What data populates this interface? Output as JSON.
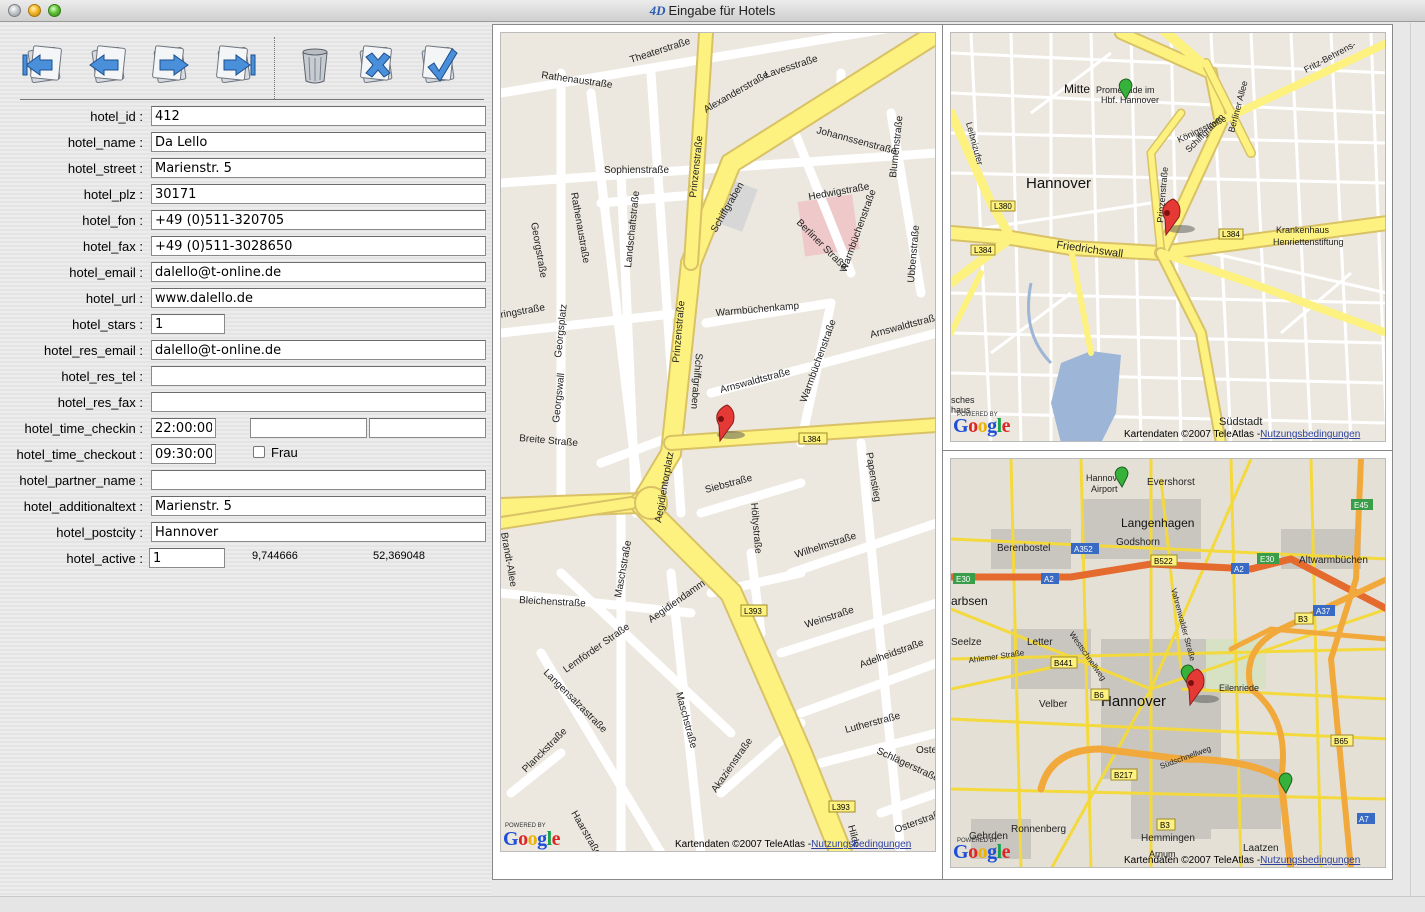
{
  "window": {
    "logo": "4D",
    "title": "Eingabe für Hotels"
  },
  "toolbar": {
    "buttons": [
      {
        "name": "first-record",
        "icon": "first-record-icon"
      },
      {
        "name": "previous-record",
        "icon": "previous-record-icon"
      },
      {
        "name": "next-record",
        "icon": "next-record-icon"
      },
      {
        "name": "last-record",
        "icon": "last-record-icon"
      },
      {
        "name": "delete-record",
        "icon": "trash-icon"
      },
      {
        "name": "cancel",
        "icon": "cancel-icon"
      },
      {
        "name": "accept",
        "icon": "accept-icon"
      }
    ]
  },
  "form": {
    "hotel_id": {
      "label": "hotel_id :",
      "value": "412"
    },
    "hotel_name": {
      "label": "hotel_name :",
      "value": "Da Lello"
    },
    "hotel_street": {
      "label": "hotel_street :",
      "value": "Marienstr. 5"
    },
    "hotel_plz": {
      "label": "hotel_plz :",
      "value": "30171"
    },
    "hotel_fon": {
      "label": "hotel_fon :",
      "value": "+49 (0)511-320705"
    },
    "hotel_fax": {
      "label": "hotel_fax :",
      "value": "+49 (0)511-3028650"
    },
    "hotel_email": {
      "label": "hotel_email :",
      "value": "dalello@t-online.de"
    },
    "hotel_url": {
      "label": "hotel_url :",
      "value": "www.dalello.de"
    },
    "hotel_stars": {
      "label": "hotel_stars :",
      "value": "1"
    },
    "hotel_res_email": {
      "label": "hotel_res_email :",
      "value": "dalello@t-online.de"
    },
    "hotel_res_tel": {
      "label": "hotel_res_tel :",
      "value": ""
    },
    "hotel_res_fax": {
      "label": "hotel_res_fax :",
      "value": ""
    },
    "hotel_time_checkin": {
      "label": "hotel_time_checkin :",
      "value": "22:00:00",
      "extra1": "",
      "extra2": ""
    },
    "hotel_time_checkout": {
      "label": "hotel_time_checkout :",
      "value": "09:30:00"
    },
    "frau": {
      "label": "Frau",
      "checked": false
    },
    "hotel_partner_name": {
      "label": "hotel_partner_name :",
      "value": ""
    },
    "hotel_additionaltext": {
      "label": "hotel_additionaltext :",
      "value": "Marienstr. 5"
    },
    "hotel_postcity": {
      "label": "hotel_postcity :",
      "value": "Hannover"
    },
    "hotel_active": {
      "label": "hotel_active :",
      "value": "1"
    },
    "longitude": "9,744666",
    "latitude": "52,369048"
  },
  "maps": {
    "attribution": "Kartendaten ©2007 TeleAtlas -",
    "terms_link": "Nutzungsbedingungen",
    "google": "Google",
    "powered_by": "POWERED BY",
    "detail": {
      "streets": [
        "Theaterstraße",
        "Rathenaustraße",
        "Lavesstraße",
        "Alexanderstraße",
        "Johannssenstraße",
        "Sophienstraße",
        "Prinzenstraße",
        "Schiffgraben",
        "Hedwigstraße",
        "Blumenstraße",
        "Berliner Straße",
        "Warmbüchenstraße",
        "Ubbenstraße",
        "Georgstraße",
        "Landschaftstraße",
        "Georgsplatz",
        "Warmbüchenkamp",
        "Amswaldtstraße",
        "Georgswall",
        "Arnswaldtstraße",
        "Breite Straße",
        "L384",
        "Papenstieg",
        "Aegidientorplatz",
        "Siebstraße",
        "Höltystraße",
        "Wilhelmstraße",
        "Bleichenstraße",
        "Maschstraße",
        "Aegidiendamm",
        "L393",
        "Weinstraße",
        "Lemförder Straße",
        "Adelheidstraße",
        "Langensalzastraße",
        "Lutherstraße",
        "Akazienstraße",
        "Schlägerstraße",
        "Planckstraße",
        "Osterstraße",
        "Hildesheimer"
      ]
    },
    "city": {
      "labels": [
        "Mitte",
        "Promenade im Hbf. Hannover",
        "Hannover",
        "Krankenhaus Henriettenstiftung",
        "Südstadt",
        "Friedrichswall",
        "Königsstraße",
        "Schiffgraben",
        "Berliner Allee",
        "Prinzenstraße",
        "Fritz-Behrens-",
        "Leibnizufer",
        "L380",
        "L384",
        "Maschsee",
        "Hannover"
      ]
    },
    "region": {
      "labels": [
        "Hannover Airport",
        "Evershorst",
        "Langenhagen",
        "Berenbostel",
        "Godshorn",
        "Altwarmbüchen",
        "Garbsen",
        "Seelze",
        "Letter",
        "Ahlemer Straße",
        "Hannover",
        "Eilenriede",
        "Velber",
        "Ronnenberg",
        "Hemmingen",
        "Laatzen",
        "Gehrden",
        "Arnum",
        "Südschnellweg",
        "Westschnellweg",
        "Vahrenwalder Straße"
      ],
      "shields": [
        "A352",
        "B522",
        "E45",
        "E30",
        "A2",
        "A37",
        "B3",
        "B441",
        "B6",
        "B65",
        "B217",
        "A7"
      ]
    }
  }
}
